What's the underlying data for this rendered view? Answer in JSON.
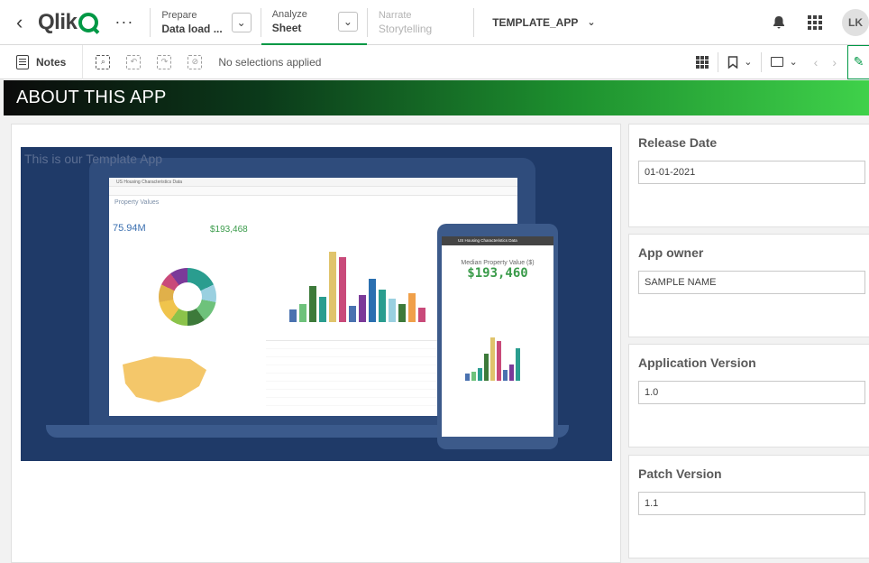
{
  "nav": {
    "back_icon": "chevron-left-icon",
    "logo_text": "Qlik",
    "more_icon": "ellipsis-icon",
    "prepare": {
      "label": "Prepare",
      "value": "Data load ..."
    },
    "analyze": {
      "label": "Analyze",
      "value": "Sheet"
    },
    "narrate": {
      "label": "Narrate",
      "value": "Storytelling"
    },
    "app_name": "TEMPLATE_APP",
    "avatar": "LK"
  },
  "toolbar": {
    "notes_label": "Notes",
    "selections_text": "No selections applied"
  },
  "sheet": {
    "title": "ABOUT THIS APP",
    "intro_text": "This is our Template App"
  },
  "hero": {
    "laptop_header": "US Housing Characteristics Data",
    "laptop_section": "Property Values",
    "kpi_units": "75.94M",
    "kpi_price": "$193,468",
    "phone_header": "US Housing Characteristics Data",
    "phone_label": "Median Property Value ($)",
    "phone_value": "$193,460"
  },
  "cards": [
    {
      "title": "Release Date",
      "value": "01-01-2021"
    },
    {
      "title": "App owner",
      "value": "SAMPLE NAME"
    },
    {
      "title": "Application Version",
      "value": "1.0"
    },
    {
      "title": "Patch Version",
      "value": "1.1"
    }
  ],
  "colors": {
    "qlik_green": "#009845",
    "title_gradient_start": "#0b0b0b",
    "title_gradient_end": "#3fd14a",
    "hero_bg": "#1f3a68"
  }
}
